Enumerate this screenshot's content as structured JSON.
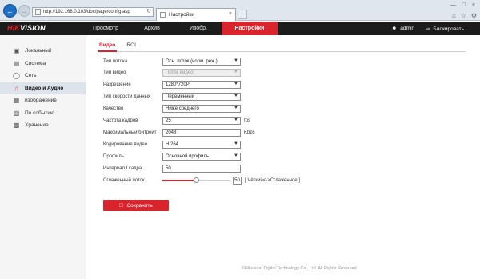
{
  "browser": {
    "url": "http://192.168.0.103/doc/page/config.asp",
    "tab_title": "Настройки"
  },
  "header": {
    "logo_part1": "HIK",
    "logo_part2": "VISION",
    "nav": [
      "Просмотр",
      "Архив",
      "Изобр.",
      "Настройки"
    ],
    "user": "admin",
    "logout": "Блокировать"
  },
  "sidebar": {
    "items": [
      {
        "label": "Локальный",
        "icon": "monitor-icon"
      },
      {
        "label": "Система",
        "icon": "system-icon"
      },
      {
        "label": "Сеть",
        "icon": "globe-icon"
      },
      {
        "label": "Видео и Аудио",
        "icon": "video-audio-icon"
      },
      {
        "label": "изображение",
        "icon": "image-icon"
      },
      {
        "label": "По событию",
        "icon": "calendar-icon"
      },
      {
        "label": "Хранение",
        "icon": "storage-icon"
      }
    ]
  },
  "content": {
    "tabs": [
      "Видео",
      "ROI"
    ],
    "fields": {
      "stream_type": {
        "label": "Тип потока",
        "value": "Осн. поток (норм. реж.)"
      },
      "video_type": {
        "label": "Тип видео",
        "value": "Поток видео"
      },
      "resolution": {
        "label": "Разрешение",
        "value": "1280*720P"
      },
      "bitrate_type": {
        "label": "Тип скорости данных",
        "value": "Переменный"
      },
      "quality": {
        "label": "Качество",
        "value": "Ниже среднего"
      },
      "frame_rate": {
        "label": "Частота кадров",
        "value": "25",
        "unit": "fps"
      },
      "max_bitrate": {
        "label": "Максимальный битрейт",
        "value": "2048",
        "unit": "Kbps"
      },
      "video_encoding": {
        "label": "Кодирование видео",
        "value": "H.264"
      },
      "profile": {
        "label": "Профиль",
        "value": "Основной профиль"
      },
      "i_frame_interval": {
        "label": "Интервал I кадра",
        "value": "50"
      },
      "smoothing": {
        "label": "Сглаженный поток",
        "value": "50",
        "level": 0.5,
        "hint": "[ Чёткий<->Сглаженное ]"
      }
    },
    "save_label": "Сохранить",
    "footer": "©Hikvision Digital Technology Co., Ltd. All Rights Reserved."
  },
  "colors": {
    "accent": "#d9232d",
    "header_bg": "#1c1c1c"
  }
}
